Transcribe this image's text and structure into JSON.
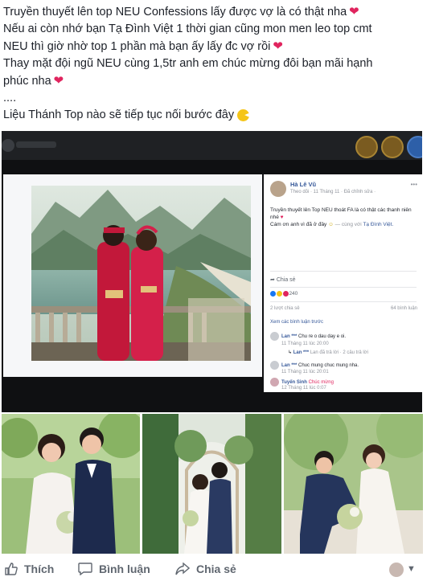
{
  "post": {
    "line1": "Truyền thuyết lên top NEU Confessions lấy được vợ là có thật nha",
    "line2": "Nếu ai còn nhớ bạn Tạ Đình Việt 1 thời gian cũng mon men leo top cmt",
    "line3": "NEU thì giờ nhờ top 1 phần mà bạn ấy lấy đc vợ rồi",
    "line4": "Thay mặt đội ngũ NEU cùng 1,5tr anh em chúc mừng đôi bạn mãi hạnh",
    "line5": "phúc nha",
    "line6": "....",
    "line7": "Liệu Thánh Top nào sẽ tiếp tục nối bước đây"
  },
  "embedded": {
    "author": "Hà Lê Vũ",
    "meta": "Theo dõi · 11 Tháng 11 · Đã chỉnh sửa ·",
    "caption1": "Truyền thuyết lên Top NEU thoát FA là có thật các thanh niên nhé",
    "caption2": "Cám ơn anh vì đã ở đây",
    "caption_with": "— cùng với",
    "caption_tag": "Tạ Đình Việt.",
    "share_label": "Chia sẻ",
    "reaction_count": "240",
    "shares": "2 lượt chia sẻ",
    "comments_count": "64 bình luận",
    "older_comments": "Xem các bình luận trước",
    "c1_user": "Lan ***",
    "c1_text": "Chu re o dau day e oi.",
    "c1_time": "11 Tháng 11 lúc 20:00",
    "c2_user": "Lan ***",
    "c2_text": "Lan đã trả lời · 2 câu trả lời",
    "c3_user": "Lan ***",
    "c3_text": "Chuc mung chuc mung nha.",
    "c3_time": "11 Tháng 11 lúc 20:01",
    "c4_user": "Tuyến Sinh",
    "c4_text": "Chúc mừng",
    "c4_time": "12 Tháng 11 lúc 0:07"
  },
  "actions": {
    "like": "Thích",
    "comment": "Bình luận",
    "share": "Chia sẻ"
  },
  "colors": {
    "heart": "#e0245e",
    "link": "#365899",
    "muted": "#606770"
  }
}
